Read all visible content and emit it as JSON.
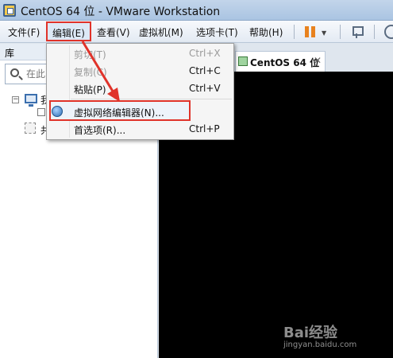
{
  "window": {
    "title": "CentOS 64 位 - VMware Workstation"
  },
  "menubar": {
    "items": [
      {
        "label": "文件(F)"
      },
      {
        "label": "编辑(E)"
      },
      {
        "label": "查看(V)"
      },
      {
        "label": "虚拟机(M)"
      },
      {
        "label": "选项卡(T)"
      },
      {
        "label": "帮助(H)"
      }
    ],
    "toolbar_icons": [
      "pause-icon",
      "network-icon",
      "help-icon"
    ]
  },
  "library": {
    "title": "库",
    "search_placeholder": "在此",
    "tree": [
      {
        "label": "我"
      },
      {
        "label": "共"
      }
    ]
  },
  "tabs": [
    {
      "label": "CentOS 64 位",
      "close": "✕"
    }
  ],
  "edit_menu": {
    "items": [
      {
        "label": "剪切(T)",
        "shortcut": "Ctrl+X",
        "enabled": false
      },
      {
        "label": "复制(C)",
        "shortcut": "Ctrl+C",
        "enabled": false
      },
      {
        "label": "粘贴(P)",
        "shortcut": "Ctrl+V",
        "enabled": true
      },
      {
        "label": "虚拟网络编辑器(N)...",
        "shortcut": "",
        "enabled": true
      },
      {
        "label": "首选项(R)...",
        "shortcut": "Ctrl+P",
        "enabled": true
      }
    ]
  },
  "annotation": {
    "color": "#e0332a"
  },
  "watermark": {
    "brand": "Bai经验",
    "url": "jingyan.baidu.com"
  },
  "colors": {
    "highlight_border": "#e0332a",
    "vm_screen": "#000000"
  }
}
